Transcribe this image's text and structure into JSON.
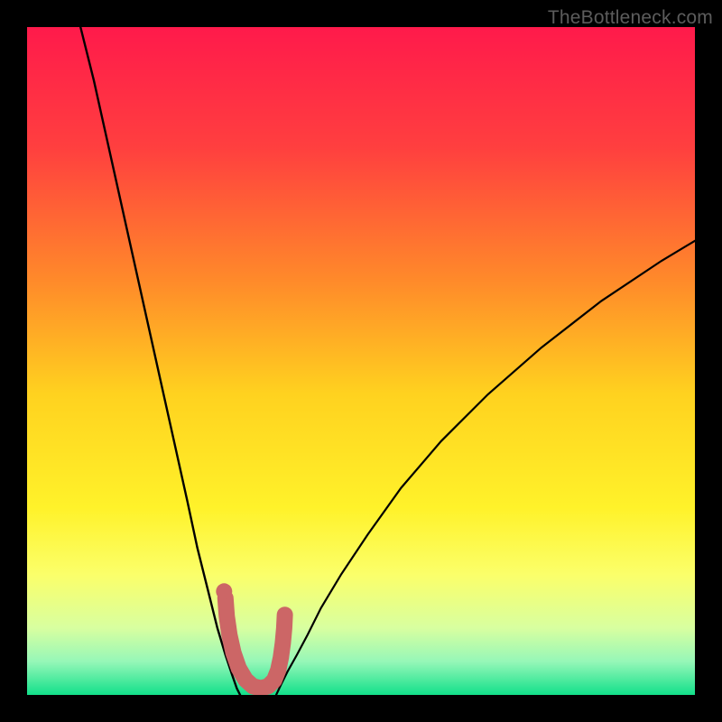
{
  "watermark": "TheBottleneck.com",
  "chart_data": {
    "type": "line",
    "title": "",
    "xlabel": "",
    "ylabel": "",
    "xlim": [
      0,
      100
    ],
    "ylim": [
      0,
      100
    ],
    "gradient_stops": [
      {
        "offset": 0,
        "color": "#ff1a4b"
      },
      {
        "offset": 0.18,
        "color": "#ff3f3f"
      },
      {
        "offset": 0.38,
        "color": "#ff8a2a"
      },
      {
        "offset": 0.55,
        "color": "#ffd21f"
      },
      {
        "offset": 0.72,
        "color": "#fff22a"
      },
      {
        "offset": 0.82,
        "color": "#fbff6a"
      },
      {
        "offset": 0.9,
        "color": "#d8ffa0"
      },
      {
        "offset": 0.95,
        "color": "#96f7b8"
      },
      {
        "offset": 1.0,
        "color": "#12e08a"
      }
    ],
    "series": [
      {
        "name": "left-curve",
        "x": [
          8,
          10,
          12,
          14,
          16,
          18,
          20,
          22,
          24,
          25.5,
          27,
          28.5,
          29.7,
          30.7,
          31.4,
          31.9
        ],
        "y": [
          100,
          92,
          83,
          74,
          65,
          56,
          47,
          38,
          29,
          22,
          16,
          10,
          6,
          3,
          1,
          0
        ]
      },
      {
        "name": "right-curve",
        "x": [
          37.3,
          38,
          39,
          40.4,
          42,
          44,
          47,
          51,
          56,
          62,
          69,
          77,
          86,
          95,
          100
        ],
        "y": [
          0,
          1.5,
          3.5,
          6,
          9,
          13,
          18,
          24,
          31,
          38,
          45,
          52,
          59,
          65,
          68
        ]
      },
      {
        "name": "valley-marker",
        "marker_color": "#cc6666",
        "points": [
          {
            "x": 29.5,
            "y": 15.5,
            "type": "dot"
          }
        ],
        "stroke": [
          {
            "x": 29.7,
            "y": 14.5
          },
          {
            "x": 29.9,
            "y": 11.8
          },
          {
            "x": 30.3,
            "y": 9.0
          },
          {
            "x": 30.9,
            "y": 6.3
          },
          {
            "x": 31.7,
            "y": 4.0
          },
          {
            "x": 32.7,
            "y": 2.3
          },
          {
            "x": 33.8,
            "y": 1.3
          },
          {
            "x": 35.0,
            "y": 1.0
          },
          {
            "x": 36.1,
            "y": 1.3
          },
          {
            "x": 37.0,
            "y": 2.2
          },
          {
            "x": 37.6,
            "y": 3.7
          },
          {
            "x": 38.0,
            "y": 5.6
          },
          {
            "x": 38.3,
            "y": 7.8
          },
          {
            "x": 38.5,
            "y": 10.0
          },
          {
            "x": 38.6,
            "y": 12.0
          }
        ]
      }
    ]
  }
}
